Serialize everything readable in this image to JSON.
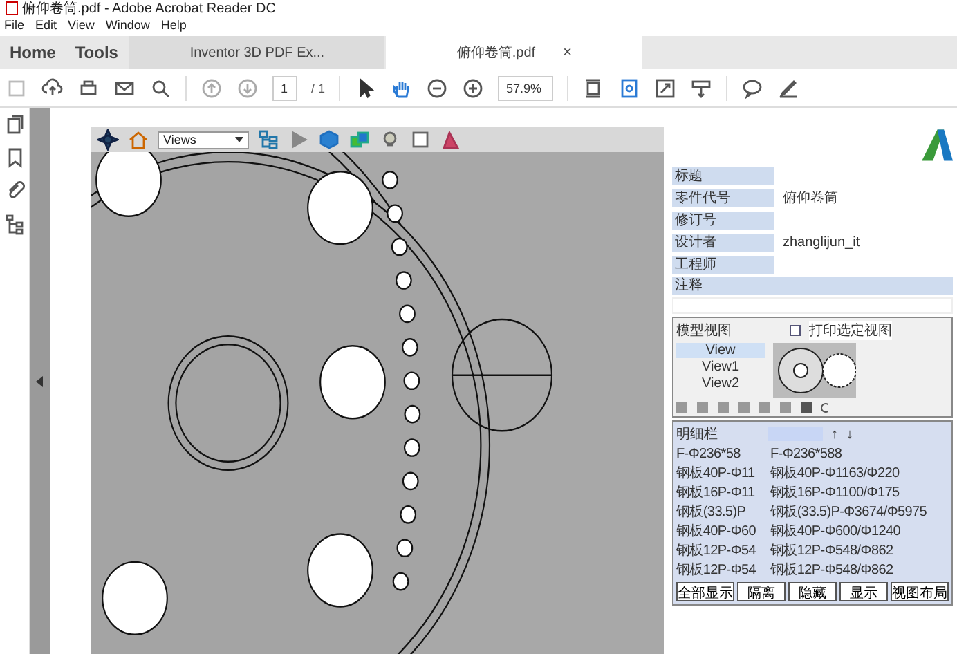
{
  "window": {
    "title": "俯仰卷筒.pdf - Adobe Acrobat Reader DC"
  },
  "menu": [
    "File",
    "Edit",
    "View",
    "Window",
    "Help"
  ],
  "tabs": [
    {
      "label": "Home",
      "kind": "nav",
      "selected": false
    },
    {
      "label": "Tools",
      "kind": "nav",
      "selected": false
    },
    {
      "label": "Inventor 3D PDF Ex...",
      "kind": "doc",
      "selected": false
    },
    {
      "label": "俯仰卷筒.pdf",
      "kind": "doc",
      "selected": true,
      "close": "×"
    }
  ],
  "toolbar": {
    "page": "1",
    "page_total": "/ 1",
    "zoom": "57.9%"
  },
  "viewer_toolbar": {
    "views": "Views"
  },
  "title_block": {
    "fields": [
      {
        "label": "标题"
      },
      {
        "label": "零件代号",
        "value": "俯仰卷筒"
      },
      {
        "label": "修订号"
      },
      {
        "label": "设计者",
        "value": "zhanglijun_it"
      },
      {
        "label": "工程师"
      }
    ],
    "notes": "注释"
  },
  "model_views": {
    "title": "模型视图",
    "print_label": "打印选定视图",
    "print_checked": false,
    "views": [
      {
        "label": "View",
        "selected": true
      },
      {
        "label": "View1",
        "selected": false
      },
      {
        "label": "View2",
        "selected": false
      }
    ]
  },
  "bom": {
    "title": "明细栏",
    "sort": [
      "↑",
      "↓"
    ],
    "rows": [
      {
        "part": "F-Φ236*58",
        "desc": "F-Φ236*588"
      },
      {
        "part": "钢板40P-Φ11",
        "desc": "钢板40P-Φ1163/Φ220"
      },
      {
        "part": "钢板16P-Φ11",
        "desc": "钢板16P-Φ1100/Φ175"
      },
      {
        "part": "钢板(33.5)P",
        "desc": "钢板(33.5)P-Φ3674/Φ5975"
      },
      {
        "part": "钢板40P-Φ60",
        "desc": "钢板40P-Φ600/Φ1240"
      },
      {
        "part": "钢板12P-Φ54",
        "desc": "钢板12P-Φ548/Φ862"
      },
      {
        "part": "钢板12P-Φ54",
        "desc": "钢板12P-Φ548/Φ862"
      }
    ],
    "buttons": [
      "全部显示",
      "隔离",
      "隐藏",
      "显示",
      "视图布局"
    ]
  }
}
